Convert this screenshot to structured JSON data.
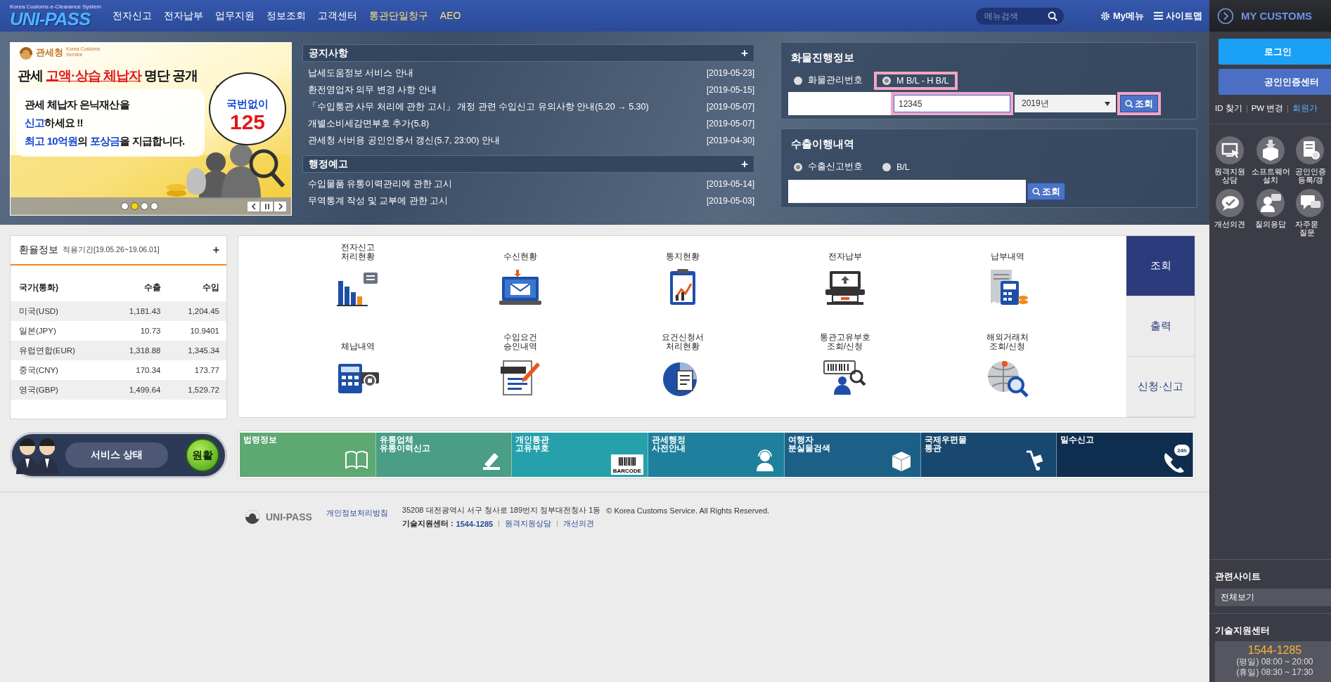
{
  "top_nav": {
    "logo": {
      "tagline": "Korea Customs e-Clearance System",
      "name": "UNI-PASS"
    },
    "menu": [
      {
        "label": "전자신고",
        "kind": "main"
      },
      {
        "label": "전자납부",
        "kind": "main"
      },
      {
        "label": "업무지원",
        "kind": "main"
      },
      {
        "label": "정보조회",
        "kind": "main"
      },
      {
        "label": "고객센터",
        "kind": "main"
      },
      {
        "label": "통관단일창구",
        "kind": "special"
      },
      {
        "label": "AEO",
        "kind": "special"
      }
    ],
    "search": {
      "placeholder": "메뉴검색"
    },
    "links": [
      {
        "label": "My메뉴",
        "kind": "gear"
      },
      {
        "label": "사이트맵",
        "kind": "menu"
      }
    ]
  },
  "banner": {
    "agency": "관세청",
    "agency_en": "Korea Customs\nService",
    "headline": [
      {
        "text": "관세 ",
        "accent": false
      },
      {
        "text": "고액·상습 체납자",
        "accent": true
      },
      {
        "text": " 명단 공개",
        "accent": false
      }
    ],
    "lines": [
      [
        {
          "text": "관세 체납자 은닉재산을",
          "accent": false
        }
      ],
      [
        {
          "text": "신고",
          "accent": true
        },
        {
          "text": "하세요 !!",
          "accent": false
        }
      ],
      [
        {
          "text": "최고 10억원",
          "accent": true
        },
        {
          "text": "의 ",
          "accent": false
        },
        {
          "text": "포상금",
          "accent": true
        },
        {
          "text": "을 지급합니다.",
          "accent": false
        }
      ]
    ],
    "callout": {
      "label": "국번없이",
      "number": "125"
    },
    "dots": [
      {
        "selected": false
      },
      {
        "selected": true
      },
      {
        "selected": false
      },
      {
        "selected": false
      }
    ]
  },
  "notices": [
    {
      "title": "공지사항",
      "more": "+",
      "items": [
        {
          "text": "납세도움정보 서비스 안내",
          "date": "[2019-05-23]"
        },
        {
          "text": "환전영업자 의무 변경 사항 안내",
          "date": "[2019-05-15]"
        },
        {
          "text": "「수입통관 사무 처리에 관한 고시」 개정 관련 수입신고 유의사항 안내(5.20 → 5.30)",
          "date": "[2019-05-07]"
        },
        {
          "text": "개별소비세감면부호 추가(5.8)",
          "date": "[2019-05-07]"
        },
        {
          "text": "관세청 서버용 공인인증서 갱신(5.7, 23:00) 안내",
          "date": "[2019-04-30]"
        }
      ]
    },
    {
      "title": "행정예고",
      "more": "+",
      "items": [
        {
          "text": "수입물품 유통이력관리에 관한 고시",
          "date": "[2019-05-14]"
        },
        {
          "text": "무역통계 작성 및 교부에 관한 고시",
          "date": "[2019-05-03]"
        }
      ]
    }
  ],
  "cargo": {
    "title": "화물진행정보",
    "options": [
      {
        "label": "화물관리번호",
        "selected": false,
        "highlighted": false
      },
      {
        "label": "M B/L - H B/L",
        "selected": true,
        "highlighted": true
      }
    ],
    "fields": [
      {
        "highlighted": false
      },
      {
        "value": "12345",
        "highlighted": true
      }
    ],
    "year": "2019년",
    "button": {
      "label": "조회",
      "highlighted": true
    }
  },
  "export": {
    "title": "수출이행내역",
    "options": [
      {
        "label": "수출신고번호",
        "selected": true
      },
      {
        "label": "B/L",
        "selected": false
      }
    ],
    "button": {
      "label": "조회"
    }
  },
  "exchange": {
    "title": "환율정보",
    "period": "적용기간[19.05.26~19.06.01]",
    "more": "+",
    "columns": [
      "국가(통화)",
      "수출",
      "수입"
    ],
    "rows": [
      [
        "미국(USD)",
        "1,181.43",
        "1,204.45"
      ],
      [
        "일본(JPY)",
        "10.73",
        "10.9401"
      ],
      [
        "유럽연합(EUR)",
        "1,318.88",
        "1,345.34"
      ],
      [
        "중국(CNY)",
        "170.34",
        "173.77"
      ],
      [
        "영국(GBP)",
        "1,499.64",
        "1,529.72"
      ]
    ]
  },
  "services": {
    "items": [
      {
        "label": "전자신고\n처리현황"
      },
      {
        "label": "수신현황"
      },
      {
        "label": "통지현황"
      },
      {
        "label": "전자납부"
      },
      {
        "label": "납부내역"
      },
      {
        "label": "체납내역"
      },
      {
        "label": "수입요건\n승인내역"
      },
      {
        "label": "요건신청서\n처리현황"
      },
      {
        "label": "통관고유부호\n조회/신청"
      },
      {
        "label": "해외거래처\n조회/신청"
      }
    ],
    "tabs": [
      {
        "label": "조회",
        "selected": true
      },
      {
        "label": "출력",
        "selected": false
      },
      {
        "label": "신청·신고",
        "selected": false
      }
    ]
  },
  "status": {
    "label": "서비스 상태",
    "value": "원활"
  },
  "quick_links": [
    {
      "label": "법령정보"
    },
    {
      "label": "유통업체\n유통이력신고"
    },
    {
      "label": "개인통관\n고유부호",
      "icon_text": "BARCODE"
    },
    {
      "label": "관세행정\n사전안내"
    },
    {
      "label": "여행자\n분실물검색"
    },
    {
      "label": "국제우편물\n통관"
    },
    {
      "label": "밀수신고",
      "icon_text": "24h"
    }
  ],
  "footer": {
    "logo": "UNI-PASS",
    "privacy": "개인정보처리방침",
    "address": "35208 대전광역시 서구 청사로 189번지 정부대전청사 1동",
    "copyright": "© Korea Customs Service. All Rights Reserved.",
    "support_label": "기술지원센터 :",
    "support_phone": "1544-1285",
    "links": [
      "원격지원상담",
      "개선의견"
    ]
  },
  "sidebar": {
    "title": "MY CUSTOMS",
    "buttons": [
      {
        "label": "로그인",
        "kind": "primary"
      },
      {
        "label": "공인인증센터",
        "kind": "secondary"
      }
    ],
    "account_links": [
      {
        "label": "ID 찾기",
        "kind": "plain"
      },
      {
        "label": "PW 변경",
        "kind": "plain"
      },
      {
        "label": "회원가",
        "kind": "signup"
      }
    ],
    "shortcuts": [
      {
        "label": "원격지원\n상담"
      },
      {
        "label": "소프트웨어\n설치"
      },
      {
        "label": "공인인증\n등록/갱"
      },
      {
        "label": "개선의견"
      },
      {
        "label": "질의응답"
      },
      {
        "label": "자주묻\n질문"
      }
    ],
    "related": {
      "title": "관련사이트",
      "select": "전체보기"
    },
    "support": {
      "title": "기술지원센터",
      "phone": "1544-1285",
      "hours": [
        "(평일) 08:00 ~ 20:00",
        "(휴일) 08:30 ~ 17:30"
      ]
    }
  }
}
